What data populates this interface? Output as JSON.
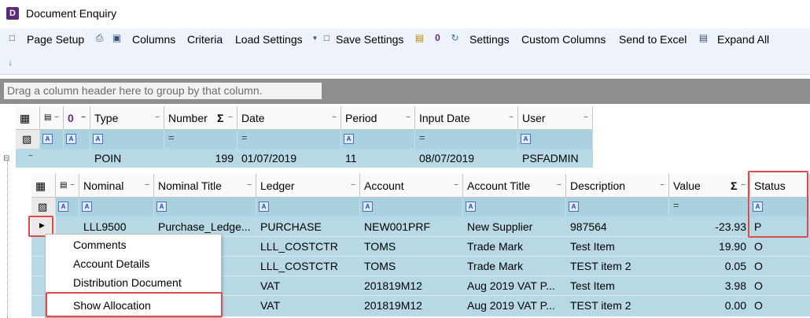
{
  "window": {
    "title": "Document Enquiry",
    "icon_letter": "D"
  },
  "toolbar": {
    "page_setup": "Page Setup",
    "columns": "Columns",
    "criteria": "Criteria",
    "load_settings": "Load Settings",
    "save_settings": "Save Settings",
    "settings": "Settings",
    "custom_columns": "Custom Columns",
    "send_to_excel": "Send to Excel",
    "expand_all": "Expand All",
    "zero_glyph": "0"
  },
  "group_prompt": "Drag a column header here to group by that column.",
  "header_grid": {
    "columns": {
      "zero": "0",
      "type": "Type",
      "number": "Number",
      "date": "Date",
      "period": "Period",
      "input_date": "Input Date",
      "user": "User"
    },
    "row": {
      "type": "POIN",
      "number": "199",
      "date": "01/07/2019",
      "period": "11",
      "input_date": "08/07/2019",
      "user": "PSFADMIN"
    }
  },
  "detail_grid": {
    "columns": {
      "nominal": "Nominal",
      "nominal_title": "Nominal Title",
      "ledger": "Ledger",
      "account": "Account",
      "account_title": "Account Title",
      "description": "Description",
      "value": "Value",
      "status": "Status"
    },
    "rows": [
      {
        "nominal": "LLL9500",
        "nominal_title": "Purchase_Ledge...",
        "ledger": "PURCHASE",
        "account": "NEW001PRF",
        "account_title": "New Supplier",
        "description": "987564",
        "value": "-23.93",
        "status": "P"
      },
      {
        "nominal": "",
        "nominal_title": "",
        "ledger": "LLL_COSTCTR",
        "account": "TOMS",
        "account_title": "Trade Mark",
        "description": "Test Item",
        "value": "19.90",
        "status": "O"
      },
      {
        "nominal": "",
        "nominal_title": "",
        "ledger": "LLL_COSTCTR",
        "account": "TOMS",
        "account_title": "Trade Mark",
        "description": "TEST item 2",
        "value": "0.05",
        "status": "O"
      },
      {
        "nominal": "",
        "nominal_title": "",
        "ledger": "VAT",
        "account": "201819M12",
        "account_title": "Aug 2019 VAT P...",
        "description": "Test Item",
        "value": "3.98",
        "status": "O"
      },
      {
        "nominal": "",
        "nominal_title": "",
        "ledger": "VAT",
        "account": "201819M12",
        "account_title": "Aug 2019 VAT P...",
        "description": "TEST item 2",
        "value": "0.00",
        "status": "O"
      }
    ]
  },
  "context_menu": {
    "items": [
      "Comments",
      "Account Details",
      "Distribution Document",
      "Show Allocation"
    ]
  },
  "colors": {
    "row_fill": "#b7d9e6",
    "filter_fill": "#a9d1e0",
    "highlight": "#e24a4a"
  }
}
